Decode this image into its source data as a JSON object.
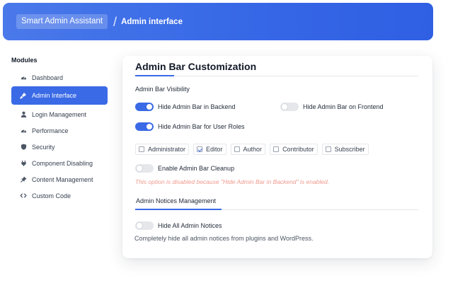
{
  "header": {
    "app_name": "Smart Admin Assistant",
    "separator": "/",
    "current_page": "Admin interface"
  },
  "sidebar": {
    "heading": "Modules",
    "items": [
      {
        "label": "Dashboard",
        "icon": "gauge-icon",
        "active": false
      },
      {
        "label": "Admin Interface",
        "icon": "brush-icon",
        "active": true
      },
      {
        "label": "Login Management",
        "icon": "user-icon",
        "active": false
      },
      {
        "label": "Performance",
        "icon": "gauge-icon",
        "active": false
      },
      {
        "label": "Security",
        "icon": "shield-icon",
        "active": false
      },
      {
        "label": "Component Disabling",
        "icon": "plug-icon",
        "active": false
      },
      {
        "label": "Content Management",
        "icon": "pin-icon",
        "active": false
      },
      {
        "label": "Custom Code",
        "icon": "code-icon",
        "active": false
      }
    ]
  },
  "card": {
    "title": "Admin Bar Customization",
    "visibility_label": "Admin Bar Visibility",
    "toggles": {
      "hide_backend": {
        "label": "Hide Admin Bar in Backend",
        "on": true
      },
      "hide_frontend": {
        "label": "Hide Admin Bar on Frontend",
        "on": false
      },
      "hide_roles": {
        "label": "Hide Admin Bar for User Roles",
        "on": true
      },
      "cleanup": {
        "label": "Enable Admin Bar Cleanup",
        "on": false
      }
    },
    "roles": [
      {
        "label": "Administrator",
        "checked": false
      },
      {
        "label": "Editor",
        "checked": true
      },
      {
        "label": "Author",
        "checked": false
      },
      {
        "label": "Contributor",
        "checked": false
      },
      {
        "label": "Subscriber",
        "checked": false
      }
    ],
    "disabled_note": "This option is disabled because \"Hide Admin Bar in Backend\" is enabled.",
    "notices_label": "Admin Notices Management",
    "hide_notices": {
      "label": "Hide All Admin Notices",
      "on": false
    },
    "notices_description": "Completely hide all admin notices from plugins and WordPress."
  },
  "colors": {
    "accent": "#3a6ae6",
    "warning_text": "#f09a8e"
  }
}
